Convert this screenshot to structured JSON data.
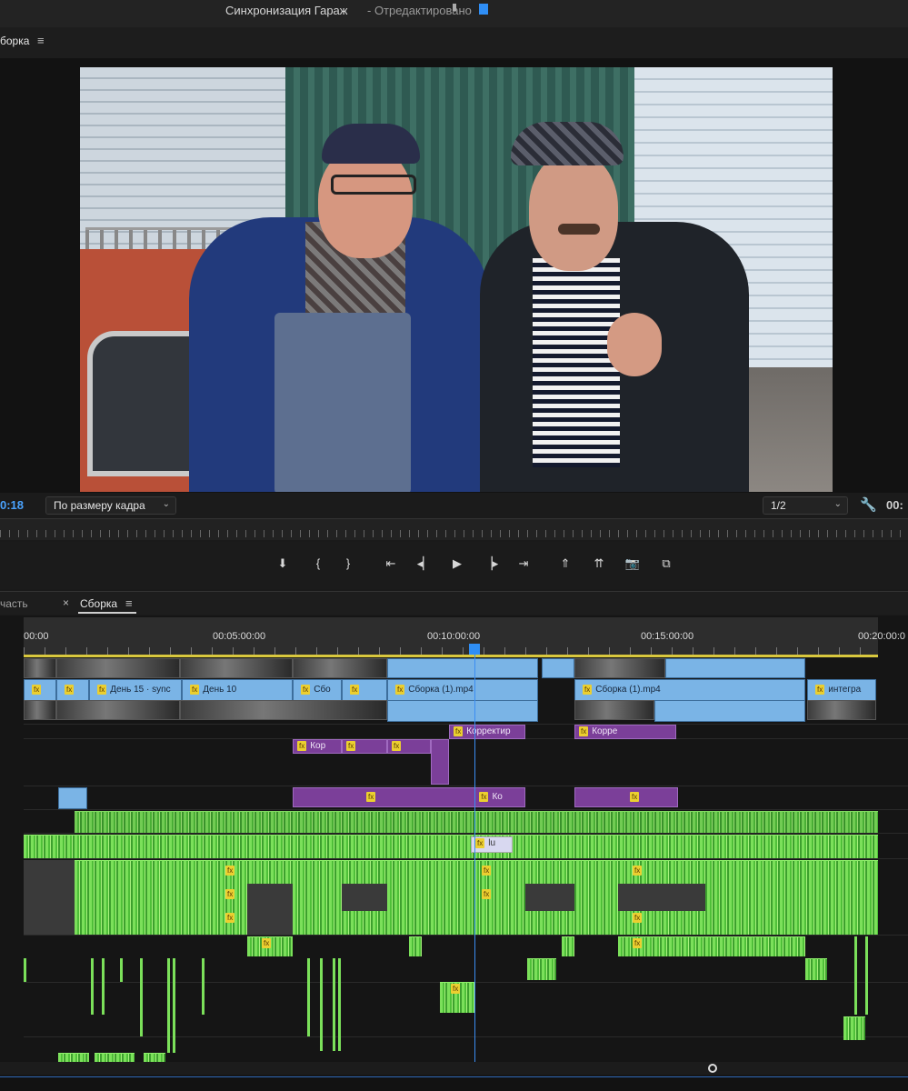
{
  "window": {
    "title": "Синхронизация Гараж",
    "status": "- Отредактировано"
  },
  "monitor": {
    "panel_tab": "борка",
    "menu_glyph": "≡",
    "timecode_left": "0:18",
    "fit_label": "По размеру кадра",
    "resolution_label": "1/2",
    "timecode_right": "00:",
    "wrench_glyph": "🔧"
  },
  "transport": {
    "buttons": [
      {
        "name": "add-marker-button",
        "glyph": "⬇"
      },
      {
        "name": "mark-in-button",
        "glyph": "{"
      },
      {
        "name": "mark-out-button",
        "glyph": "}"
      },
      {
        "name": "go-to-in-button",
        "glyph": "⇤"
      },
      {
        "name": "step-back-button",
        "glyph": "◂▏"
      },
      {
        "name": "play-button",
        "glyph": "▶"
      },
      {
        "name": "step-forward-button",
        "glyph": "▕▸"
      },
      {
        "name": "go-to-out-button",
        "glyph": "⇥"
      },
      {
        "name": "lift-button",
        "glyph": "⇑"
      },
      {
        "name": "extract-button",
        "glyph": "⇈"
      },
      {
        "name": "export-frame-button",
        "glyph": "📷"
      },
      {
        "name": "compare-button",
        "glyph": "⧉"
      }
    ]
  },
  "sequence": {
    "left_tab": "часть",
    "close_glyph": "×",
    "active_tab": "Сборка",
    "menu_glyph": "≡"
  },
  "ruler": {
    "labels": [
      "00:00",
      "00:05:00:00",
      "00:10:00:00",
      "00:15:00:00",
      "00:20:00:0"
    ]
  },
  "clips": {
    "video": {
      "fx": "fx",
      "day15": "День 15 · sync",
      "day10": "День 10",
      "sbo": "Сбо",
      "sborka1": "Сборка (1).mp4",
      "sborka2": "Сборка (1).mp4",
      "integra": "интегра"
    },
    "adjust": {
      "korrektir": "Корректир",
      "korre": "Корре",
      "kor": "Кор",
      "ko": "Ко",
      "lu": "lu"
    }
  }
}
